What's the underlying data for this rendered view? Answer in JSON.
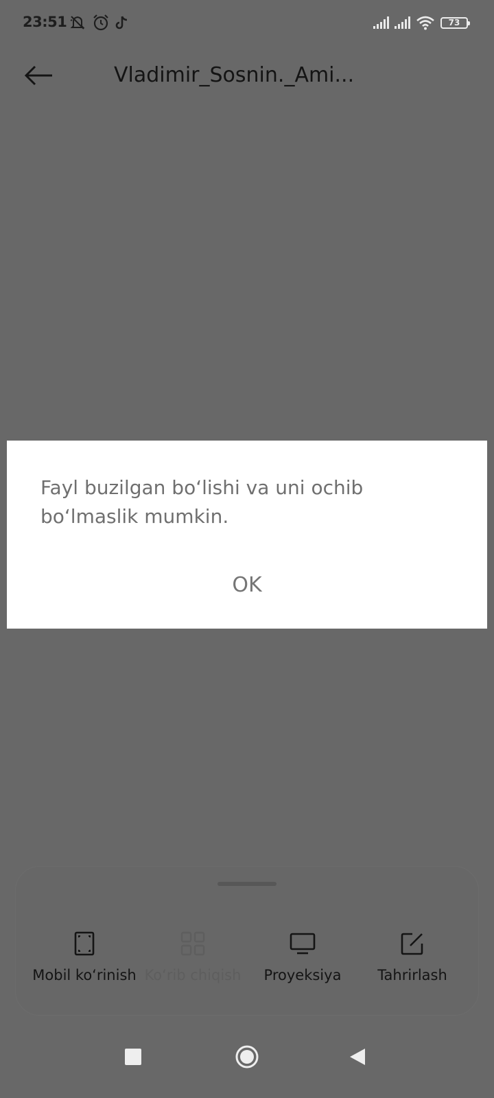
{
  "status_bar": {
    "time": "23:51",
    "battery": "73",
    "left_icons": [
      "mute-icon",
      "alarm-icon",
      "tiktok-icon"
    ],
    "right_icons": [
      "signal-icon",
      "signal-icon",
      "wifi-icon",
      "battery-icon"
    ]
  },
  "app_bar": {
    "title": "Vladimir_Sosnin._Ami..."
  },
  "dialog": {
    "message": "Fayl buzilgan boʻlishi va uni ochib boʻlmaslik mumkin.",
    "ok_label": "OK"
  },
  "bottom_sheet": {
    "items": [
      {
        "label": "Mobil koʻrinish",
        "icon": "fullscreen-icon",
        "enabled": true
      },
      {
        "label": "Koʻrib chiqish",
        "icon": "grid-icon",
        "enabled": false
      },
      {
        "label": "Proyeksiya",
        "icon": "monitor-icon",
        "enabled": true
      },
      {
        "label": "Tahrirlash",
        "icon": "edit-icon",
        "enabled": true
      }
    ]
  },
  "colors": {
    "scrim": "#686868",
    "dialog_bg": "#ffffff",
    "dialog_text": "#6f6f6f"
  }
}
